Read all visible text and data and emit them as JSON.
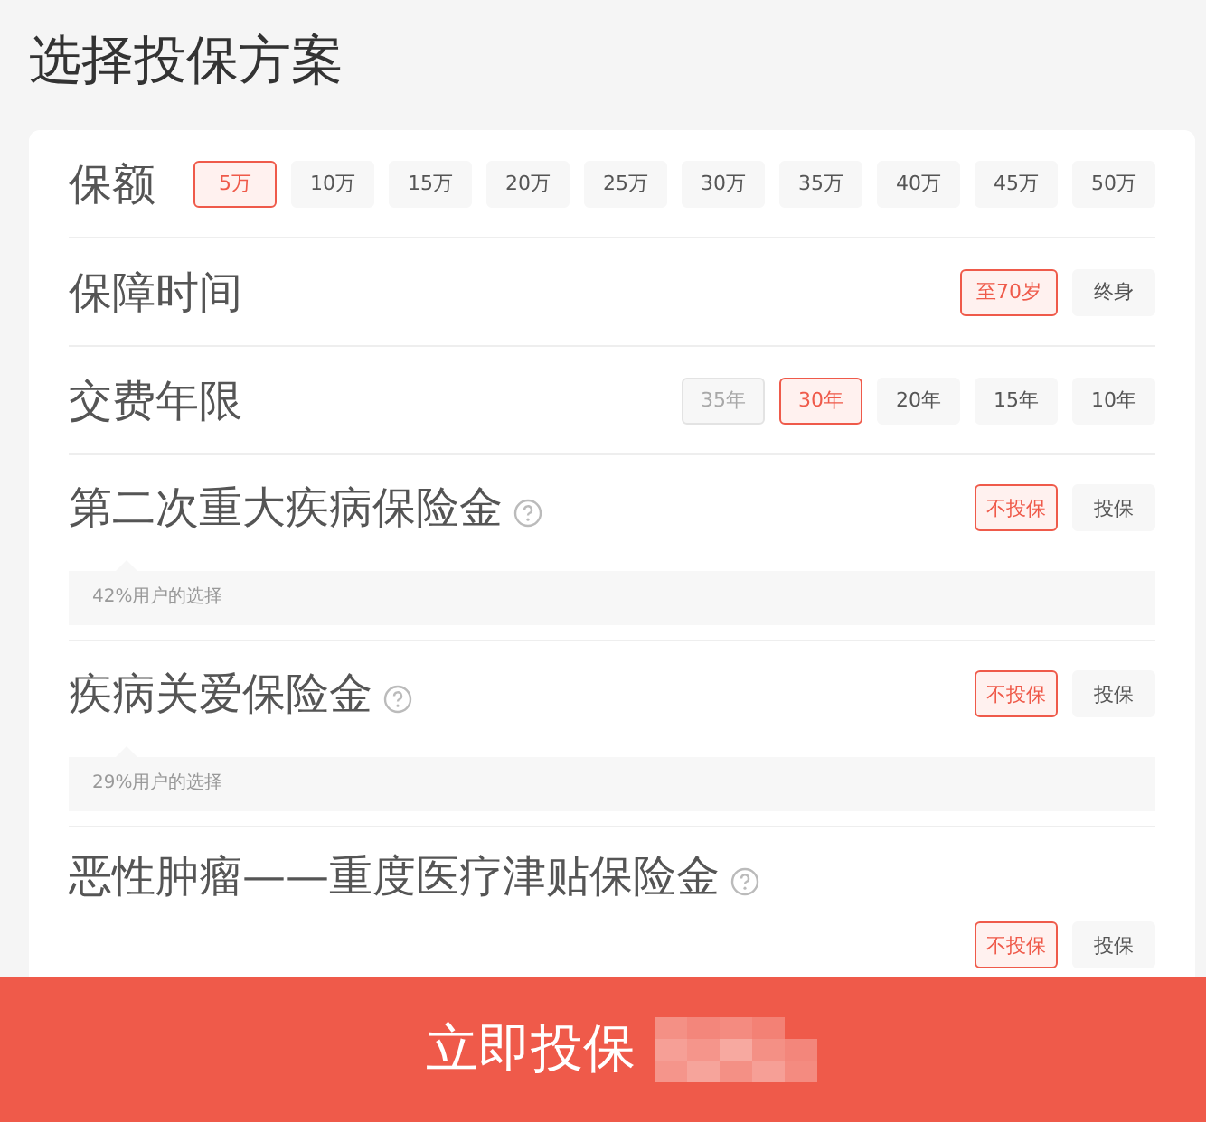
{
  "title": "选择投保方案",
  "rows": [
    {
      "label": "保额",
      "help": false,
      "stacked": false,
      "options": [
        {
          "label": "5万",
          "selected": true,
          "disabled": false
        },
        {
          "label": "10万",
          "selected": false,
          "disabled": false
        },
        {
          "label": "15万",
          "selected": false,
          "disabled": false
        },
        {
          "label": "20万",
          "selected": false,
          "disabled": false
        },
        {
          "label": "25万",
          "selected": false,
          "disabled": false
        },
        {
          "label": "30万",
          "selected": false,
          "disabled": false
        },
        {
          "label": "35万",
          "selected": false,
          "disabled": false
        },
        {
          "label": "40万",
          "selected": false,
          "disabled": false
        },
        {
          "label": "45万",
          "selected": false,
          "disabled": false
        },
        {
          "label": "50万",
          "selected": false,
          "disabled": false
        }
      ]
    },
    {
      "label": "保障时间",
      "help": false,
      "stacked": false,
      "options": [
        {
          "label": "至70岁",
          "selected": true,
          "disabled": false
        },
        {
          "label": "终身",
          "selected": false,
          "disabled": false
        }
      ]
    },
    {
      "label": "交费年限",
      "help": false,
      "stacked": false,
      "options": [
        {
          "label": "35年",
          "selected": false,
          "disabled": true
        },
        {
          "label": "30年",
          "selected": true,
          "disabled": false
        },
        {
          "label": "20年",
          "selected": false,
          "disabled": false
        },
        {
          "label": "15年",
          "selected": false,
          "disabled": false
        },
        {
          "label": "10年",
          "selected": false,
          "disabled": false
        }
      ]
    },
    {
      "label": "第二次重大疾病保险金",
      "help": true,
      "stacked": false,
      "hint": "42%用户的选择",
      "options": [
        {
          "label": "不投保",
          "selected": true,
          "disabled": false
        },
        {
          "label": "投保",
          "selected": false,
          "disabled": false
        }
      ]
    },
    {
      "label": "疾病关爱保险金",
      "help": true,
      "stacked": false,
      "hint": "29%用户的选择",
      "options": [
        {
          "label": "不投保",
          "selected": true,
          "disabled": false
        },
        {
          "label": "投保",
          "selected": false,
          "disabled": false
        }
      ]
    },
    {
      "label": "恶性肿瘤——重度医疗津贴保险金",
      "help": true,
      "stacked": true,
      "options": [
        {
          "label": "不投保",
          "selected": true,
          "disabled": false
        },
        {
          "label": "投保",
          "selected": false,
          "disabled": false
        }
      ]
    }
  ],
  "submit": "立即投保"
}
